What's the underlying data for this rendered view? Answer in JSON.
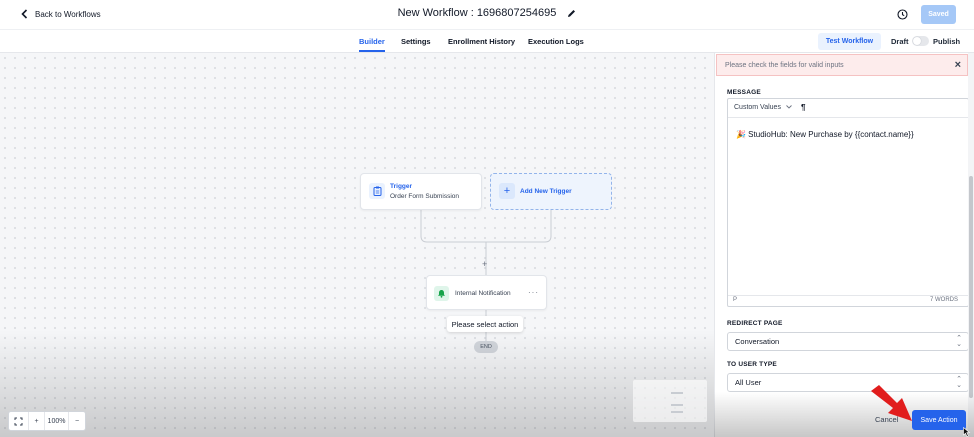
{
  "header": {
    "back_label": "Back to Workflows",
    "workflow_title": "New Workflow : 1696807254695",
    "saved_label": "Saved"
  },
  "tabs": [
    {
      "label": "Builder",
      "active": true
    },
    {
      "label": "Settings",
      "active": false
    },
    {
      "label": "Enrollment History",
      "active": false
    },
    {
      "label": "Execution Logs",
      "active": false
    }
  ],
  "toolbar": {
    "test_workflow_label": "Test Workflow",
    "draft_label": "Draft",
    "publish_label": "Publish",
    "publish_enabled": false
  },
  "canvas": {
    "trigger": {
      "title": "Trigger",
      "subtitle": "Order Form Submission"
    },
    "add_trigger_label": "Add New Trigger",
    "action": {
      "label": "Internal Notification",
      "menu": "···"
    },
    "select_action_tooltip": "Please select action",
    "end_label": "END",
    "plus_label": "+",
    "zoom": {
      "level": "100%",
      "plus": "+",
      "minus": "−"
    }
  },
  "panel": {
    "alert_text": "Please check the fields for valid inputs",
    "close_symbol": "×",
    "message_label": "MESSAGE",
    "custom_values_label": "Custom Values",
    "paragraph_symbol": "¶",
    "message_text": "🎉 StudioHub: New Purchase by {{contact.name}}",
    "footer_tag": "P",
    "word_count": "7 WORDS",
    "redirect_label": "REDIRECT PAGE",
    "redirect_value": "Conversation",
    "user_type_label": "TO USER TYPE",
    "user_type_value": "All User",
    "cancel_label": "Cancel",
    "save_action_label": "Save Action"
  },
  "colors": {
    "primary": "#2563eb",
    "saved_disabled": "#a5c8f7",
    "alert_bg": "#fdecec",
    "annotation_arrow": "#e11d1d"
  }
}
